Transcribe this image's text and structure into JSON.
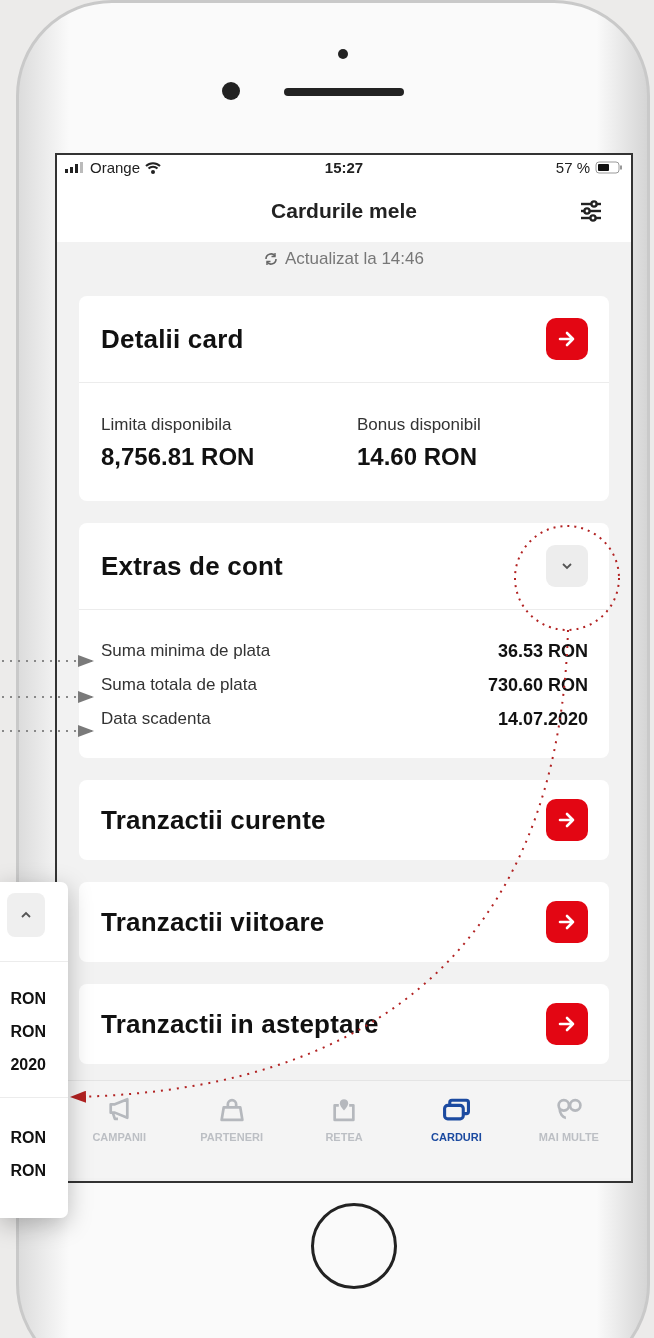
{
  "status_bar": {
    "carrier": "Orange",
    "time": "15:27",
    "battery": "57 %"
  },
  "nav_bar": {
    "title": "Cardurile mele"
  },
  "updated": "Actualizat la 14:46",
  "card_details": {
    "title": "Detalii card",
    "fields": [
      {
        "label": "Limita disponibila",
        "value": "8,756.81 RON"
      },
      {
        "label": "Bonus disponibil",
        "value": "14.60 RON"
      }
    ]
  },
  "statement": {
    "title": "Extras de cont",
    "expanded": false,
    "rows": [
      {
        "label": "Suma minima de plata",
        "value": "36.53 RON"
      },
      {
        "label": "Suma totala de plata",
        "value": "730.60 RON"
      },
      {
        "label": "Data scadenta",
        "value": "14.07.2020"
      }
    ]
  },
  "link_cards": [
    {
      "title": "Tranzactii curente"
    },
    {
      "title": "Tranzactii viitoare"
    },
    {
      "title": "Tranzactii in asteptare"
    }
  ],
  "tab_bar": [
    {
      "label": "CAMPANII",
      "kind": "megaphone",
      "selected": false
    },
    {
      "label": "PARTENERI",
      "kind": "bag",
      "selected": false
    },
    {
      "label": "RETEA",
      "kind": "pin",
      "selected": false
    },
    {
      "label": "CARDURI",
      "kind": "cards",
      "selected": true
    },
    {
      "label": "MAI MULTE",
      "kind": "loop",
      "selected": false
    }
  ],
  "callout_card": {
    "expanded": true,
    "values": [
      "RON",
      "RON",
      "2020"
    ],
    "values_2": [
      "RON",
      "RON"
    ]
  }
}
